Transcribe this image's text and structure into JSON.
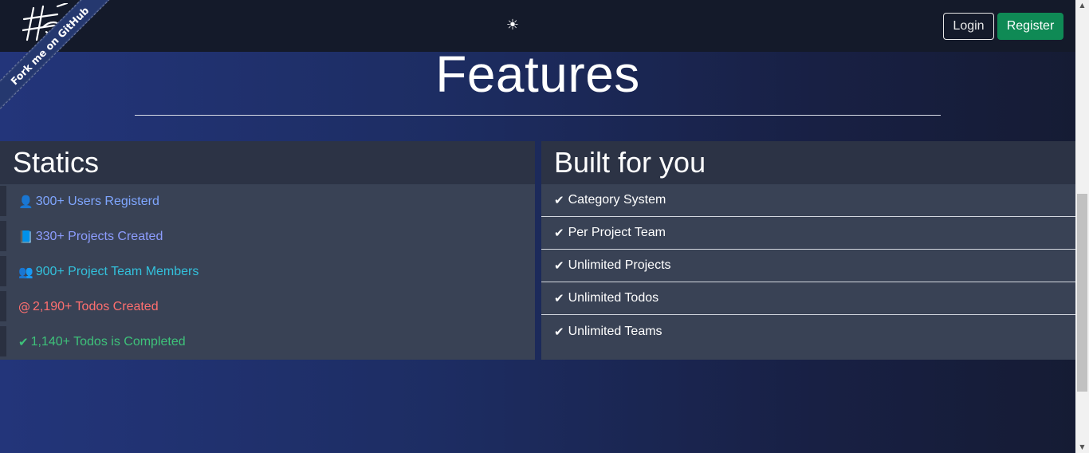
{
  "navbar": {
    "theme_toggle_icon": "☀",
    "login_label": "Login",
    "register_label": "Register"
  },
  "ribbon": {
    "label": "Fork me on GitHub"
  },
  "page": {
    "title": "Features"
  },
  "statics": {
    "heading": "Statics",
    "items": [
      {
        "icon": "user-icon",
        "glyph": "👤",
        "label": "300+ Users Registerd",
        "color": "#7fa6ff"
      },
      {
        "icon": "book-icon",
        "glyph": "📘",
        "label": "330+ Projects Created",
        "color": "#8d9dff"
      },
      {
        "icon": "users-icon",
        "glyph": "👥",
        "label": "900+ Project Team Members",
        "color": "#33c1dc"
      },
      {
        "icon": "at-icon",
        "glyph": "@",
        "label": "2,190+ Todos Created",
        "color": "#ff6f6f"
      },
      {
        "icon": "check-icon",
        "glyph": "✔",
        "label": "1,140+ Todos is Completed",
        "color": "#3ec27a"
      }
    ]
  },
  "built_for_you": {
    "heading": "Built for you",
    "check_glyph": "✔",
    "items": [
      "Category System",
      "Per Project Team",
      "Unlimited Projects",
      "Unlimited Todos",
      "Unlimited Teams"
    ]
  }
}
